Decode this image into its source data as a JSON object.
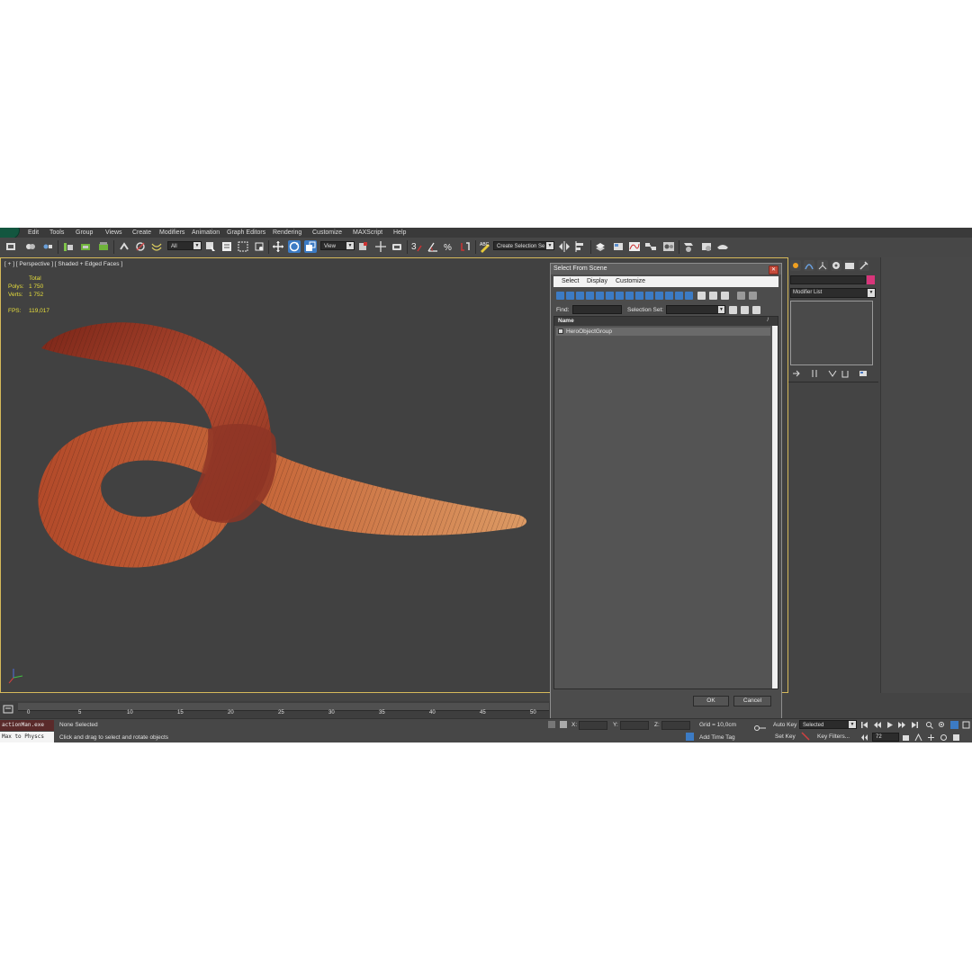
{
  "app": {
    "menu": [
      "Edit",
      "Tools",
      "Group",
      "Views",
      "Create",
      "Modifiers",
      "Animation",
      "Graph Editors",
      "Rendering",
      "Customize",
      "MAXScript",
      "Help"
    ]
  },
  "toolbar": {
    "filter_value": "All",
    "refcoord_value": "View",
    "selection_set_placeholder": "Create Selection Se",
    "snap_value": "3"
  },
  "viewport": {
    "label": "[ + ] [ Perspective ] [ Shaded + Edged Faces ]",
    "stats": {
      "total_label": "Total",
      "polys_label": "Polys:",
      "polys_value": "1 750",
      "verts_label": "Verts:",
      "verts_value": "1 752",
      "fps_label": "FPS:",
      "fps_value": "119,017"
    }
  },
  "dialog": {
    "title": "Select From Scene",
    "menu": [
      "Select",
      "Display",
      "Customize"
    ],
    "find_label": "Find:",
    "selection_set_label": "Selection Set:",
    "column_name": "Name",
    "items": [
      "HeroObjectGroup"
    ],
    "ok_label": "OK",
    "cancel_label": "Cancel"
  },
  "command_panel": {
    "modifier_list": "Modifier List"
  },
  "timeline": {
    "ticks": [
      "0",
      "5",
      "10",
      "15",
      "20",
      "25",
      "30",
      "35",
      "40",
      "45",
      "50"
    ]
  },
  "status": {
    "maxscript_line1": "actionMan.exe",
    "maxscript_line2": "Max to Physcs",
    "selection_text": "None Selected",
    "prompt_text": "Click and drag to select and rotate objects",
    "x_label": "X:",
    "y_label": "Y:",
    "z_label": "Z:",
    "grid_text": "Grid = 10,0cm",
    "add_time_tag": "Add Time Tag",
    "auto_key": "Auto Key",
    "set_key": "Set Key",
    "key_mode_value": "Selected",
    "key_filters": "Key Filters...",
    "frame_value": "72"
  },
  "colors": {
    "active_blue": "#3c7bc4",
    "viewport_border": "#d6b95a",
    "stats_yellow": "#e8df3c"
  }
}
